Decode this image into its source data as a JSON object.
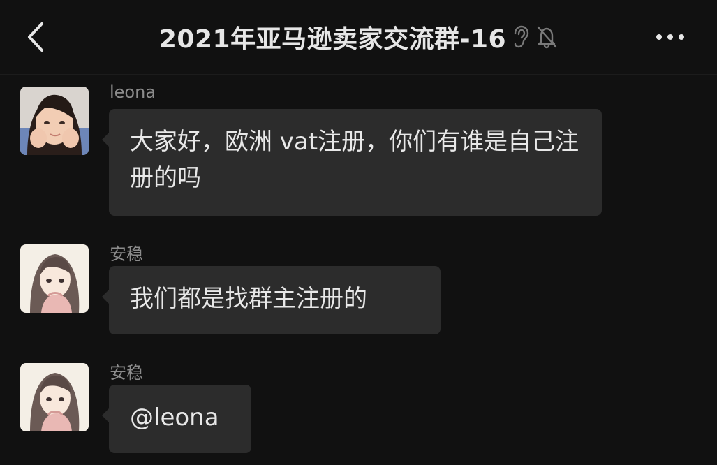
{
  "header": {
    "title": "2021年亚马逊卖家交流群-16",
    "back_icon": "chevron-left-icon",
    "earpiece_icon": "ear-icon",
    "mute_icon": "bell-muted-icon",
    "more_icon": "more-dots-icon"
  },
  "messages": [
    {
      "sender": "leona",
      "text": "大家好，欧洲 vat注册，你们有谁是自己注册的吗",
      "avatar": "avatar-photo-girl"
    },
    {
      "sender": "安稳",
      "text": "我们都是找群主注册的",
      "avatar": "avatar-illustrated-girl"
    },
    {
      "sender": "安稳",
      "text": "@leona",
      "avatar": "avatar-illustrated-girl"
    }
  ],
  "colors": {
    "background": "#111111",
    "bubble": "#2c2c2c",
    "text": "#e8e8e8",
    "sender": "#8c8c8c"
  }
}
